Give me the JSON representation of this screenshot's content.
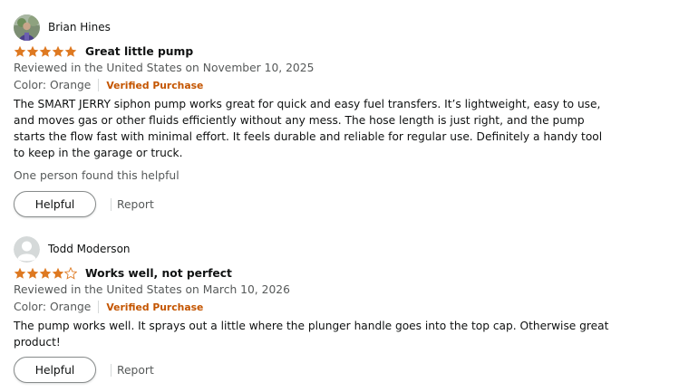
{
  "colors": {
    "star": "#de7921",
    "star_empty_stroke": "#de7921",
    "verified": "#c45500",
    "muted": "#565959",
    "text": "#0f1111"
  },
  "reviews": [
    {
      "reviewer": "Brian Hines",
      "avatar": "photo-avatar",
      "rating": 5,
      "rating_max": 5,
      "title": "Great little pump",
      "meta": "Reviewed in the United States on November 10, 2025",
      "variant": "Color: Orange",
      "verified": "Verified Purchase",
      "body": [
        "The SMART JERRY siphon pump works great for quick and easy fuel transfers. It’s lightweight, easy to use,",
        "and moves gas or other fluids efficiently without any mess. The hose length is just right, and the pump",
        "starts the flow fast with minimal effort. It feels durable and reliable for regular use. Definitely a handy tool",
        "to keep in the garage or truck."
      ],
      "helpful_count": "One person found this helpful",
      "helpful_label": "Helpful",
      "report_label": "Report"
    },
    {
      "reviewer": "Todd Moderson",
      "avatar": "default-avatar",
      "rating": 4,
      "rating_max": 5,
      "title": "Works well, not perfect",
      "meta": "Reviewed in the United States on March 10, 2026",
      "variant": "Color: Orange",
      "verified": "Verified Purchase",
      "body": [
        "The pump works well. It sprays out a little where the plunger handle goes into the top cap. Otherwise great",
        "product!"
      ],
      "helpful_count": "",
      "helpful_label": "Helpful",
      "report_label": "Report"
    }
  ]
}
